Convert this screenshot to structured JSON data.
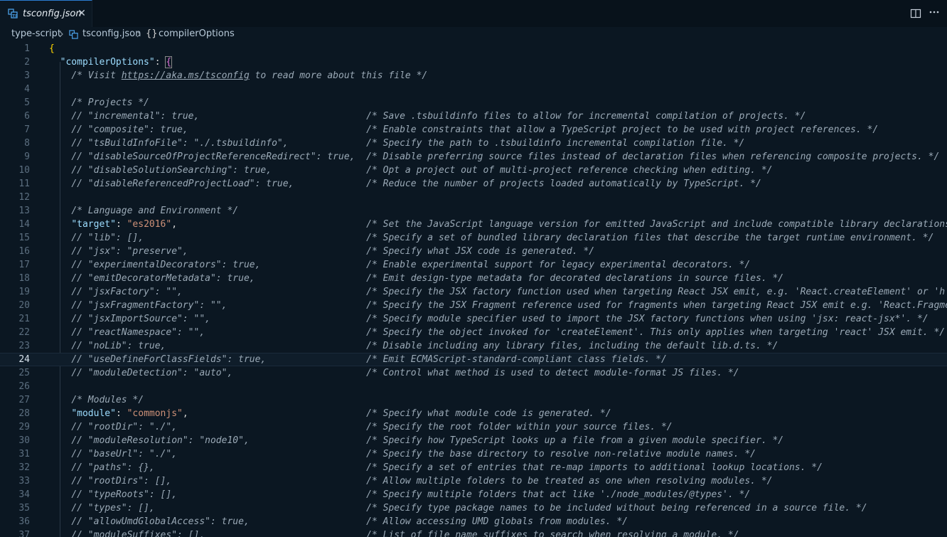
{
  "tab": {
    "label": "tsconfig.json",
    "close": "✕"
  },
  "breadcrumb": {
    "folder": "type-script",
    "file": "tsconfig.json",
    "symbol_icon": "{}",
    "symbol": "compilerOptions"
  },
  "editor": {
    "active_line": 24,
    "lines": [
      {
        "n": "1",
        "tokens": [
          {
            "t": "{",
            "c": "brace1"
          }
        ]
      },
      {
        "n": "2",
        "tokens": [
          {
            "t": "  "
          },
          {
            "t": "\"compilerOptions\"",
            "c": "key"
          },
          {
            "t": ": "
          },
          {
            "t": "{",
            "c": "brace2 cursor-box"
          }
        ]
      },
      {
        "n": "3",
        "tokens": [
          {
            "t": "    "
          },
          {
            "t": "/* Visit ",
            "c": "cm"
          },
          {
            "t": "https://aka.ms/tsconfig",
            "c": "cm url"
          },
          {
            "t": " to read more about this file */",
            "c": "cm"
          }
        ]
      },
      {
        "n": "4",
        "tokens": []
      },
      {
        "n": "5",
        "tokens": [
          {
            "t": "    "
          },
          {
            "t": "/* Projects */",
            "c": "cm"
          }
        ]
      },
      {
        "n": "6",
        "tokens": [
          {
            "t": "    "
          },
          {
            "t": "// \"incremental\": true,                              /* Save .tsbuildinfo files to allow for incremental compilation of projects. */",
            "c": "cm"
          }
        ]
      },
      {
        "n": "7",
        "tokens": [
          {
            "t": "    "
          },
          {
            "t": "// \"composite\": true,                                /* Enable constraints that allow a TypeScript project to be used with project references. */",
            "c": "cm"
          }
        ]
      },
      {
        "n": "8",
        "tokens": [
          {
            "t": "    "
          },
          {
            "t": "// \"tsBuildInfoFile\": \"./.tsbuildinfo\",              /* Specify the path to .tsbuildinfo incremental compilation file. */",
            "c": "cm"
          }
        ]
      },
      {
        "n": "9",
        "tokens": [
          {
            "t": "    "
          },
          {
            "t": "// \"disableSourceOfProjectReferenceRedirect\": true,  /* Disable preferring source files instead of declaration files when referencing composite projects. */",
            "c": "cm"
          }
        ]
      },
      {
        "n": "10",
        "tokens": [
          {
            "t": "    "
          },
          {
            "t": "// \"disableSolutionSearching\": true,                 /* Opt a project out of multi-project reference checking when editing. */",
            "c": "cm"
          }
        ]
      },
      {
        "n": "11",
        "tokens": [
          {
            "t": "    "
          },
          {
            "t": "// \"disableReferencedProjectLoad\": true,             /* Reduce the number of projects loaded automatically by TypeScript. */",
            "c": "cm"
          }
        ]
      },
      {
        "n": "12",
        "tokens": []
      },
      {
        "n": "13",
        "tokens": [
          {
            "t": "    "
          },
          {
            "t": "/* Language and Environment */",
            "c": "cm"
          }
        ]
      },
      {
        "n": "14",
        "tokens": [
          {
            "t": "    "
          },
          {
            "t": "\"target\"",
            "c": "key"
          },
          {
            "t": ": "
          },
          {
            "t": "\"es2016\"",
            "c": "str"
          },
          {
            "t": ",                                  "
          },
          {
            "t": "/* Set the JavaScript language version for emitted JavaScript and include compatible library declarations. */",
            "c": "cm"
          }
        ]
      },
      {
        "n": "15",
        "tokens": [
          {
            "t": "    "
          },
          {
            "t": "// \"lib\": [],                                        /* Specify a set of bundled library declaration files that describe the target runtime environment. */",
            "c": "cm"
          }
        ]
      },
      {
        "n": "16",
        "tokens": [
          {
            "t": "    "
          },
          {
            "t": "// \"jsx\": \"preserve\",                                /* Specify what JSX code is generated. */",
            "c": "cm"
          }
        ]
      },
      {
        "n": "17",
        "tokens": [
          {
            "t": "    "
          },
          {
            "t": "// \"experimentalDecorators\": true,                   /* Enable experimental support for legacy experimental decorators. */",
            "c": "cm"
          }
        ]
      },
      {
        "n": "18",
        "tokens": [
          {
            "t": "    "
          },
          {
            "t": "// \"emitDecoratorMetadata\": true,                    /* Emit design-type metadata for decorated declarations in source files. */",
            "c": "cm"
          }
        ]
      },
      {
        "n": "19",
        "tokens": [
          {
            "t": "    "
          },
          {
            "t": "// \"jsxFactory\": \"\",                                 /* Specify the JSX factory function used when targeting React JSX emit, e.g. 'React.createElement' or 'h'. */",
            "c": "cm"
          }
        ]
      },
      {
        "n": "20",
        "tokens": [
          {
            "t": "    "
          },
          {
            "t": "// \"jsxFragmentFactory\": \"\",                         /* Specify the JSX Fragment reference used for fragments when targeting React JSX emit e.g. 'React.Fragment' or 'Fragment'. */",
            "c": "cm"
          }
        ]
      },
      {
        "n": "21",
        "tokens": [
          {
            "t": "    "
          },
          {
            "t": "// \"jsxImportSource\": \"\",                            /* Specify module specifier used to import the JSX factory functions when using 'jsx: react-jsx*'. */",
            "c": "cm"
          }
        ]
      },
      {
        "n": "22",
        "tokens": [
          {
            "t": "    "
          },
          {
            "t": "// \"reactNamespace\": \"\",                             /* Specify the object invoked for 'createElement'. This only applies when targeting 'react' JSX emit. */",
            "c": "cm"
          }
        ]
      },
      {
        "n": "23",
        "tokens": [
          {
            "t": "    "
          },
          {
            "t": "// \"noLib\": true,                                    /* Disable including any library files, including the default lib.d.ts. */",
            "c": "cm"
          }
        ]
      },
      {
        "n": "24",
        "tokens": [
          {
            "t": "    "
          },
          {
            "t": "// \"useDefineForClassFields\": true,                  /* Emit ECMAScript-standard-compliant class fields. */",
            "c": "cm"
          }
        ]
      },
      {
        "n": "25",
        "tokens": [
          {
            "t": "    "
          },
          {
            "t": "// \"moduleDetection\": \"auto\",                        /* Control what method is used to detect module-format JS files. */",
            "c": "cm"
          }
        ]
      },
      {
        "n": "26",
        "tokens": []
      },
      {
        "n": "27",
        "tokens": [
          {
            "t": "    "
          },
          {
            "t": "/* Modules */",
            "c": "cm"
          }
        ]
      },
      {
        "n": "28",
        "tokens": [
          {
            "t": "    "
          },
          {
            "t": "\"module\"",
            "c": "key"
          },
          {
            "t": ": "
          },
          {
            "t": "\"commonjs\"",
            "c": "str"
          },
          {
            "t": ",                                "
          },
          {
            "t": "/* Specify what module code is generated. */",
            "c": "cm"
          }
        ]
      },
      {
        "n": "29",
        "tokens": [
          {
            "t": "    "
          },
          {
            "t": "// \"rootDir\": \"./\",                                  /* Specify the root folder within your source files. */",
            "c": "cm"
          }
        ]
      },
      {
        "n": "30",
        "tokens": [
          {
            "t": "    "
          },
          {
            "t": "// \"moduleResolution\": \"node10\",                     /* Specify how TypeScript looks up a file from a given module specifier. */",
            "c": "cm"
          }
        ]
      },
      {
        "n": "31",
        "tokens": [
          {
            "t": "    "
          },
          {
            "t": "// \"baseUrl\": \"./\",                                  /* Specify the base directory to resolve non-relative module names. */",
            "c": "cm"
          }
        ]
      },
      {
        "n": "32",
        "tokens": [
          {
            "t": "    "
          },
          {
            "t": "// \"paths\": {},                                      /* Specify a set of entries that re-map imports to additional lookup locations. */",
            "c": "cm"
          }
        ]
      },
      {
        "n": "33",
        "tokens": [
          {
            "t": "    "
          },
          {
            "t": "// \"rootDirs\": [],                                   /* Allow multiple folders to be treated as one when resolving modules. */",
            "c": "cm"
          }
        ]
      },
      {
        "n": "34",
        "tokens": [
          {
            "t": "    "
          },
          {
            "t": "// \"typeRoots\": [],                                  /* Specify multiple folders that act like './node_modules/@types'. */",
            "c": "cm"
          }
        ]
      },
      {
        "n": "35",
        "tokens": [
          {
            "t": "    "
          },
          {
            "t": "// \"types\": [],                                      /* Specify type package names to be included without being referenced in a source file. */",
            "c": "cm"
          }
        ]
      },
      {
        "n": "36",
        "tokens": [
          {
            "t": "    "
          },
          {
            "t": "// \"allowUmdGlobalAccess\": true,                     /* Allow accessing UMD globals from modules. */",
            "c": "cm"
          }
        ]
      },
      {
        "n": "37",
        "tokens": [
          {
            "t": "    "
          },
          {
            "t": "// \"moduleSuffixes\": [],                             /* List of file name suffixes to search when resolving a module. */",
            "c": "cm"
          }
        ]
      }
    ]
  }
}
